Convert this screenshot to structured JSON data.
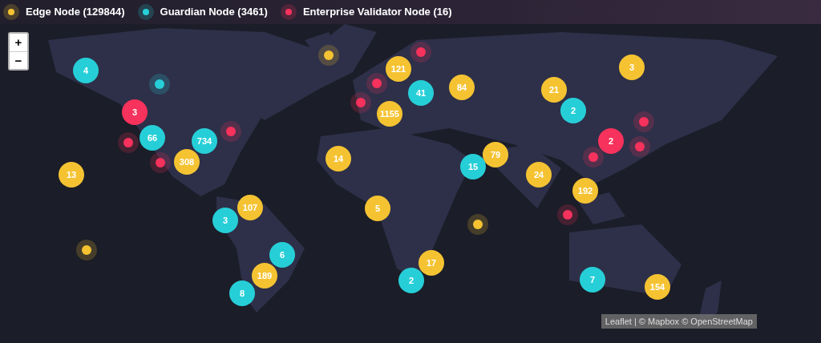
{
  "legend": [
    {
      "label": "Edge Node (129844)",
      "color": "#f5c332"
    },
    {
      "label": "Guardian Node (3461)",
      "color": "#26cfd8"
    },
    {
      "label": "Enterprise Validator Node (16)",
      "color": "#f7325c"
    }
  ],
  "map": {
    "kind": "picture",
    "zoom_controls": [
      "+",
      "−"
    ],
    "attribution": "Leaflet | © Mapbox © OpenStreetMap"
  },
  "markers": [
    {
      "kind": "cluster",
      "count": "4",
      "color": "#26cfd8"
    },
    {
      "kind": "point",
      "color": "#f5c332"
    },
    {
      "kind": "point",
      "color": "#26cfd8"
    },
    {
      "kind": "point",
      "color": "#f7325c"
    },
    {
      "kind": "point",
      "color": "#f7325c"
    },
    {
      "kind": "point",
      "color": "#f7325c"
    },
    {
      "kind": "cluster",
      "count": "121",
      "color": "#f5c332"
    },
    {
      "kind": "cluster",
      "count": "41",
      "color": "#26cfd8"
    },
    {
      "kind": "cluster",
      "count": "1155",
      "color": "#f5c332"
    },
    {
      "kind": "cluster",
      "count": "84",
      "color": "#f5c332"
    },
    {
      "kind": "cluster",
      "count": "21",
      "color": "#f5c332"
    },
    {
      "kind": "cluster",
      "count": "2",
      "color": "#26cfd8"
    },
    {
      "kind": "cluster",
      "count": "3",
      "color": "#f5c332"
    },
    {
      "kind": "cluster",
      "count": "3",
      "color": "#f7325c"
    },
    {
      "kind": "cluster",
      "count": "66",
      "color": "#26cfd8"
    },
    {
      "kind": "point",
      "color": "#f7325c"
    },
    {
      "kind": "point",
      "color": "#f7325c"
    },
    {
      "kind": "point",
      "color": "#f7325c"
    },
    {
      "kind": "cluster",
      "count": "734",
      "color": "#26cfd8"
    },
    {
      "kind": "cluster",
      "count": "308",
      "color": "#f5c332"
    },
    {
      "kind": "cluster",
      "count": "14",
      "color": "#f5c332"
    },
    {
      "kind": "cluster",
      "count": "13",
      "color": "#f5c332"
    },
    {
      "kind": "cluster",
      "count": "79",
      "color": "#f5c332"
    },
    {
      "kind": "cluster",
      "count": "15",
      "color": "#26cfd8"
    },
    {
      "kind": "cluster",
      "count": "24",
      "color": "#f5c332"
    },
    {
      "kind": "cluster",
      "count": "2",
      "color": "#f7325c"
    },
    {
      "kind": "point",
      "color": "#f7325c"
    },
    {
      "kind": "point",
      "color": "#f7325c"
    },
    {
      "kind": "point",
      "color": "#f7325c"
    },
    {
      "kind": "cluster",
      "count": "192",
      "color": "#f5c332"
    },
    {
      "kind": "point",
      "color": "#f7325c"
    },
    {
      "kind": "point",
      "color": "#f5c332"
    },
    {
      "kind": "point",
      "color": "#f5c332"
    },
    {
      "kind": "cluster",
      "count": "107",
      "color": "#f5c332"
    },
    {
      "kind": "cluster",
      "count": "3",
      "color": "#26cfd8"
    },
    {
      "kind": "cluster",
      "count": "5",
      "color": "#f5c332"
    },
    {
      "kind": "cluster",
      "count": "6",
      "color": "#26cfd8"
    },
    {
      "kind": "cluster",
      "count": "189",
      "color": "#f5c332"
    },
    {
      "kind": "cluster",
      "count": "8",
      "color": "#26cfd8"
    },
    {
      "kind": "cluster",
      "count": "17",
      "color": "#f5c332"
    },
    {
      "kind": "cluster",
      "count": "2",
      "color": "#26cfd8"
    },
    {
      "kind": "cluster",
      "count": "7",
      "color": "#26cfd8"
    },
    {
      "kind": "cluster",
      "count": "154",
      "color": "#f5c332"
    }
  ]
}
